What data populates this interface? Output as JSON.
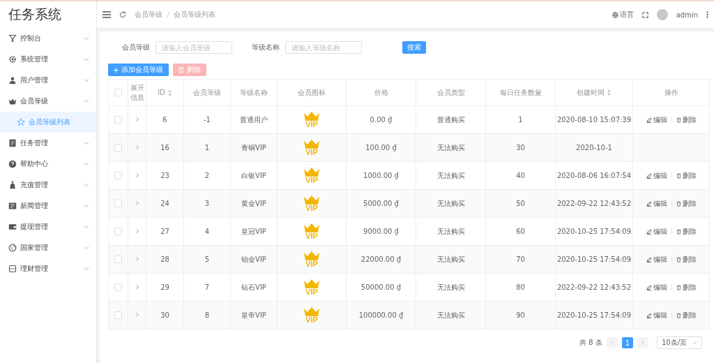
{
  "sidebar": {
    "title": "任务系统",
    "items": [
      {
        "label": "控制台",
        "expanded": false
      },
      {
        "label": "系统管理",
        "expanded": false
      },
      {
        "label": "用户管理",
        "expanded": false
      },
      {
        "label": "会员等级",
        "expanded": true,
        "children": [
          {
            "label": "会员等级列表",
            "selected": true
          }
        ]
      },
      {
        "label": "任务管理",
        "expanded": false
      },
      {
        "label": "帮助中心",
        "expanded": false
      },
      {
        "label": "充值管理",
        "expanded": false
      },
      {
        "label": "新闻管理",
        "expanded": false
      },
      {
        "label": "提现管理",
        "expanded": false
      },
      {
        "label": "国家管理",
        "expanded": false
      },
      {
        "label": "理财管理",
        "expanded": false
      }
    ]
  },
  "header": {
    "breadcrumbs": [
      "会员等级",
      "会员等级列表"
    ],
    "language": "语言",
    "user": "admin"
  },
  "filters": [
    {
      "label": "会员等级",
      "placeholder": "请输入会员等级"
    },
    {
      "label": "等级名称",
      "placeholder": "请输入等级名称"
    }
  ],
  "search_button": "搜索",
  "add_button": "添加会员等级",
  "delete_button": {
    "label": "删除",
    "disabled": true
  },
  "table": {
    "all_checked": false,
    "columns": [
      {
        "label": "展开信息",
        "sortable": false
      },
      {
        "label": "ID",
        "sortable": true
      },
      {
        "label": "会员等级",
        "sortable": false
      },
      {
        "label": "等级名称",
        "sortable": false
      },
      {
        "label": "会员图标",
        "sortable": false
      },
      {
        "label": "价格",
        "sortable": false
      },
      {
        "label": "会员类型",
        "sortable": false
      },
      {
        "label": "每日任务数量",
        "sortable": false
      },
      {
        "label": "创建时间",
        "sortable": true
      },
      {
        "label": "操作",
        "sortable": false
      }
    ],
    "rows": [
      {
        "checked": false,
        "id": "6",
        "level": "-1",
        "name": "普通用户",
        "icon_label": "VIP",
        "price": "0.00 ₫",
        "type": "普通购买",
        "daily_tasks": "1",
        "created": "2020-08-10 15:07:39",
        "actions": [
          "编辑",
          "删除"
        ]
      },
      {
        "checked": false,
        "id": "16",
        "level": "1",
        "name": "青铜VIP",
        "icon_label": "VIP",
        "price": "100.00 ₫",
        "type": "无法购买",
        "daily_tasks": "30",
        "created": "2020-10-1"
      },
      {
        "checked": false,
        "id": "23",
        "level": "2",
        "name": "白银VIP",
        "icon_label": "VIP",
        "price": "1000.00 ₫",
        "type": "无法购买",
        "daily_tasks": "40",
        "created": "2020-08-06 16:07:54",
        "actions": [
          "编辑",
          "删除"
        ]
      },
      {
        "checked": false,
        "id": "24",
        "level": "3",
        "name": "黄金VIP",
        "icon_label": "VIP",
        "price": "5000.00 ₫",
        "type": "无法购买",
        "daily_tasks": "50",
        "created": "2022-09-22 12:43:52",
        "actions": [
          "编辑",
          "删除"
        ]
      },
      {
        "checked": false,
        "id": "27",
        "level": "4",
        "name": "皇冠VIP",
        "icon_label": "VIP",
        "price": "9000.00 ₫",
        "type": "无法购买",
        "daily_tasks": "60",
        "created": "2020-10-25 17:54:09",
        "actions": [
          "编辑",
          "删除"
        ]
      },
      {
        "checked": false,
        "id": "28",
        "level": "5",
        "name": "铂金VIP",
        "icon_label": "VIP",
        "price": "22000.00 ₫",
        "type": "无法购买",
        "daily_tasks": "70",
        "created": "2020-10-25 17:54:09",
        "actions": [
          "编辑",
          "删除"
        ]
      },
      {
        "checked": false,
        "id": "29",
        "level": "7",
        "name": "钻石VIP",
        "icon_label": "VIP",
        "price": "50000.00 ₫",
        "type": "无法购买",
        "daily_tasks": "80",
        "created": "2022-09-22 12:43:52",
        "actions": [
          "编辑",
          "删除"
        ]
      },
      {
        "checked": false,
        "id": "30",
        "level": "8",
        "name": "皇帝VIP",
        "icon_label": "VIP",
        "price": "100000.00 ₫",
        "type": "无法购买",
        "daily_tasks": "90",
        "created": "2020-10-25 17:54:09",
        "actions": [
          "编辑",
          "删除"
        ]
      }
    ]
  },
  "pagination": {
    "total": "共 8 条",
    "pages": [
      {
        "label": "1",
        "selected": true
      }
    ],
    "page_size": "10条/页"
  }
}
